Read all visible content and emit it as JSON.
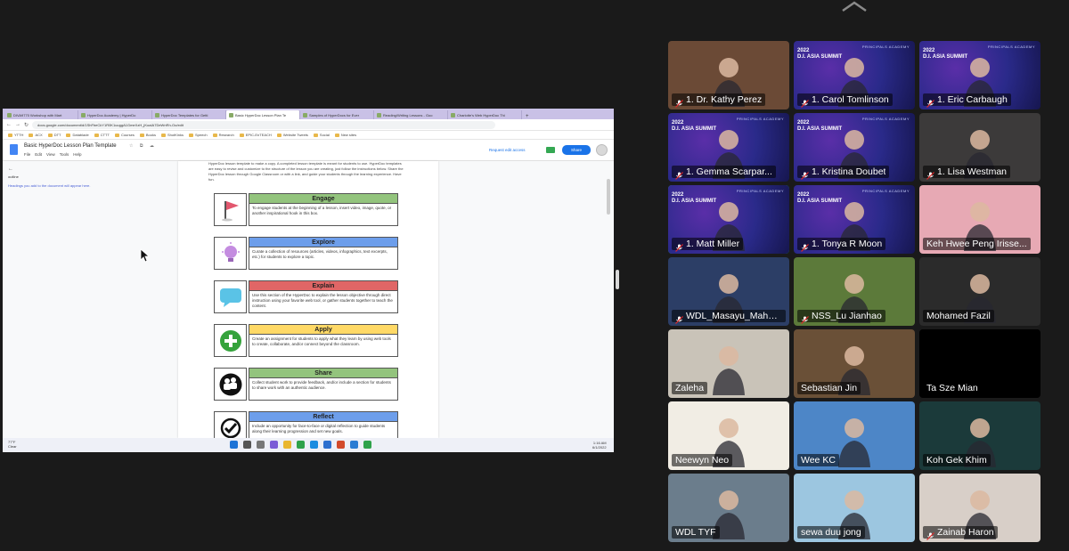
{
  "shared_screen": {
    "browser_tabs": [
      "DIVA9770 Workshop with Mart",
      "HyperDoc Academy | HyperDo",
      "HyperDoc Templates for Getti",
      "Basic HyperDoc Lesson Plan Te",
      "Samples of HyperDocs for Ever",
      "Reading/Writing Lessons - Goo",
      "Charlotte's Web HyperDoc Thi"
    ],
    "url": "docs.google.com/document/d/1ShFbeCkY1R0K1uuggA1GmeXzH_jKoaIA7DeWnRh-Oo/edit",
    "bookmarks": [
      "YTTH",
      "ACX",
      "DTT",
      "Datablade",
      "CTTT",
      "Courses",
      "Books",
      "ShotKinks",
      "Speech",
      "Research",
      "EPIC-EnTEACH",
      "Website Tweets",
      "Social",
      "New sites"
    ],
    "doc": {
      "title": "Basic HyperDoc Lesson Plan Template",
      "menu": [
        "File",
        "Edit",
        "View",
        "Tools",
        "Help"
      ],
      "request_edit": "Request edit access",
      "share": "Share"
    },
    "outline": {
      "back": "←",
      "label": "outline",
      "hint": "Headings you add to the document will appear here."
    },
    "intro": "HyperDoc lesson template to make a copy. A completed lesson template is meant for students to use. HyperDoc templates are easy to revise and customize to the structure of the lesson you are creating, just follow the instructions below. Share the HyperDoc lesson through Google Classroom or with a link, and guide your students through the learning experience. Have fun.",
    "lesson_rows": [
      {
        "heading": "Engage",
        "color": "#93c47d",
        "icon": "flag-icon",
        "desc": "To engage students at the beginning of a lesson, insert video, image, quote, or another inspirational hook in this box."
      },
      {
        "heading": "Explore",
        "color": "#6d9eeb",
        "icon": "lightbulb-icon",
        "desc": "Curate a collection of resources (articles, videos, infographics, text excerpts, etc.) for students to explore a topic."
      },
      {
        "heading": "Explain",
        "color": "#e06666",
        "icon": "speech-bubble-icon",
        "desc": "Use this section of the HyperDoc to explain the lesson objective through direct instruction using your favorite web tool, or gather students together to teach the content."
      },
      {
        "heading": "Apply",
        "color": "#ffd966",
        "icon": "plus-icon",
        "desc": "Create an assignment for students to apply what they learn by using web tools to create, collaborate, and/or connect beyond the classroom."
      },
      {
        "heading": "Share",
        "color": "#93c47d",
        "icon": "people-icon",
        "desc": "Collect student work to provide feedback, and/or include a section for students to share work with an authentic audience."
      },
      {
        "heading": "Reflect",
        "color": "#6d9eeb",
        "icon": "checkmark-icon",
        "desc": "Include an opportunity for face-to-face or digital reflection to guide students along their learning progression and set new goals."
      }
    ],
    "taskbar": {
      "weather_temp": "77°F",
      "weather_desc": "Clear",
      "time": "1:16 AM",
      "date": "6/1/2022"
    }
  },
  "participants": [
    {
      "name": "1. Dr. Kathy Perez",
      "bg": "#6b4a36",
      "muted": true
    },
    {
      "name": "1. Carol Tomlinson",
      "bg": "#2a2a8a",
      "muted": true,
      "summit": true
    },
    {
      "name": "1. Eric Carbaugh",
      "bg": "#2a2a8a",
      "muted": true,
      "summit": true
    },
    {
      "name": "1. Gemma Scarpar...",
      "bg": "#2a2a8a",
      "muted": true,
      "summit": true
    },
    {
      "name": "1. Kristina Doubet",
      "bg": "#2a2a8a",
      "muted": true,
      "summit": true
    },
    {
      "name": "1. Lisa Westman",
      "bg": "#3c3a3a",
      "muted": true
    },
    {
      "name": "1. Matt Miller",
      "bg": "#2a2a8a",
      "muted": true,
      "summit": true,
      "speaking": true
    },
    {
      "name": "1. Tonya R Moon",
      "bg": "#2a2a8a",
      "muted": true,
      "summit": true
    },
    {
      "name": "Keh Hwee Peng Irisse...",
      "bg": "#e7a9b4",
      "muted": false
    },
    {
      "name": "WDL_Masayu_Mahm...",
      "bg": "#2c3e66",
      "muted": true
    },
    {
      "name": "NSS_Lu Jianhao",
      "bg": "#5c7a3a",
      "muted": true
    },
    {
      "name": "Mohamed Fazil",
      "bg": "#2b2b2b",
      "muted": false
    },
    {
      "name": "Zaleha",
      "bg": "#c9c3b8",
      "muted": false
    },
    {
      "name": "Sebastian Jin",
      "bg": "#6a5037",
      "muted": false
    },
    {
      "name": "Ta Sze Mian",
      "bg": "#000000",
      "muted": false,
      "black": true
    },
    {
      "name": "Neewyn Neo",
      "bg": "#f1ede4",
      "muted": false
    },
    {
      "name": "Wee KC",
      "bg": "#4d86c7",
      "muted": false
    },
    {
      "name": "Koh Gek Khim",
      "bg": "#1b3a3a",
      "muted": false
    },
    {
      "name": "WDL TYF",
      "bg": "#6b7d8c",
      "muted": false
    },
    {
      "name": "sewa duu jong",
      "bg": "#9cc6e0",
      "muted": false
    },
    {
      "name": "Zainab Haron",
      "bg": "#d8cfc8",
      "muted": true
    }
  ],
  "summit_label": {
    "top": "PRINCIPALS ACADEMY",
    "main": "D.I. ASIA SUMMIT",
    "year": "2022"
  }
}
